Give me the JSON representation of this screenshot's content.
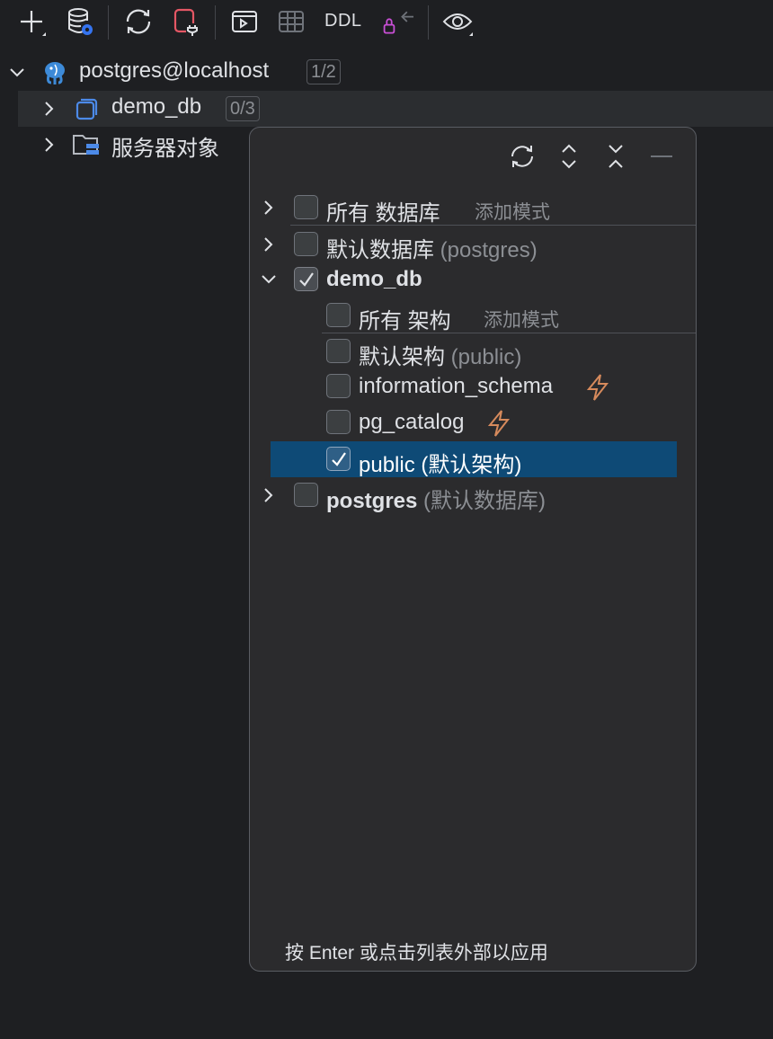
{
  "toolbar": {
    "items": [
      "add-icon",
      "datasource-settings-icon",
      "refresh-icon",
      "disconnect-icon",
      "console-icon",
      "table-icon",
      "ddl",
      "lock-jump-icon",
      "view-options-icon"
    ],
    "ddl_label": "DDL"
  },
  "tree": {
    "root": {
      "label": "postgres@localhost",
      "count": "1/2"
    },
    "items": [
      {
        "label": "demo_db",
        "count": "0/3"
      },
      {
        "label": "服务器对象"
      }
    ]
  },
  "popup": {
    "rows": {
      "all_db": {
        "label": "所有 数据库",
        "hint": "添加模式"
      },
      "default_db": {
        "label": "默认数据库",
        "suffix": "(postgres)"
      },
      "demo_db": {
        "label": "demo_db"
      },
      "all_schema": {
        "label": "所有 架构",
        "hint": "添加模式"
      },
      "default_schema": {
        "label": "默认架构",
        "suffix": "(public)"
      },
      "information_schema": {
        "label": "information_schema"
      },
      "pg_catalog": {
        "label": "pg_catalog"
      },
      "public": {
        "label": "public",
        "suffix": "(默认架构)"
      },
      "postgres": {
        "label": "postgres",
        "suffix": "(默认数据库)"
      }
    },
    "footer": "按 Enter 或点击列表外部以应用"
  },
  "colors": {
    "selection": "#0e4a76",
    "bolt": "#d68a5c",
    "db_icon": "#4c8ae8"
  }
}
